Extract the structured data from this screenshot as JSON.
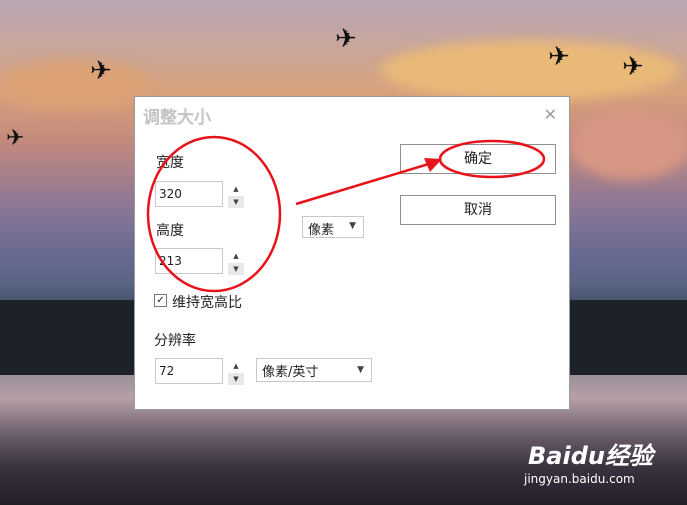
{
  "dialog": {
    "title": "调整大小",
    "width_label": "宽度",
    "width_value": "320",
    "height_label": "高度",
    "height_value": "213",
    "unit_value": "像素",
    "keep_ratio_label": "维持宽高比",
    "keep_ratio_checked": true,
    "resolution_label": "分辨率",
    "resolution_value": "72",
    "resolution_unit_value": "像素/英寸",
    "ok_label": "确定",
    "cancel_label": "取消"
  },
  "watermark": {
    "brand": "Baidu经验",
    "url": "jingyan.baidu.com"
  },
  "annotation_color": "#e8121b",
  "icons": {
    "close": "close-icon",
    "spin_up": "spin-up-icon",
    "spin_down": "spin-down-icon",
    "caret": "chevron-down-icon",
    "check": "checkmark-icon"
  }
}
